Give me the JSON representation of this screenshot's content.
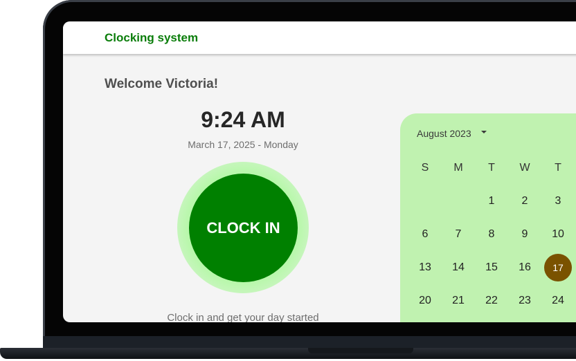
{
  "app": {
    "title": "Clocking system"
  },
  "main": {
    "welcome": "Welcome Victoria!",
    "time": "9:24 AM",
    "date": "March 17, 2025 - Monday",
    "clock_button_label": "CLOCK IN",
    "hint": "Clock in and get your day started"
  },
  "calendar": {
    "month_label": "August 2023",
    "weekdays": [
      "S",
      "M",
      "T",
      "W",
      "T"
    ],
    "rows": [
      [
        "",
        "",
        "1",
        "2",
        "3"
      ],
      [
        "6",
        "7",
        "8",
        "9",
        "10"
      ],
      [
        "13",
        "14",
        "15",
        "16",
        "17"
      ],
      [
        "20",
        "21",
        "22",
        "23",
        "24"
      ]
    ],
    "selected_day": "17"
  },
  "colors": {
    "brand_green": "#0a7d0a",
    "button_green": "#008000",
    "glow_green": "#b9f7ac",
    "calendar_bg": "#c0f2b0",
    "selected_day_bg": "#7a5200"
  },
  "icons": {
    "month_dropdown": "caret-down-icon"
  }
}
